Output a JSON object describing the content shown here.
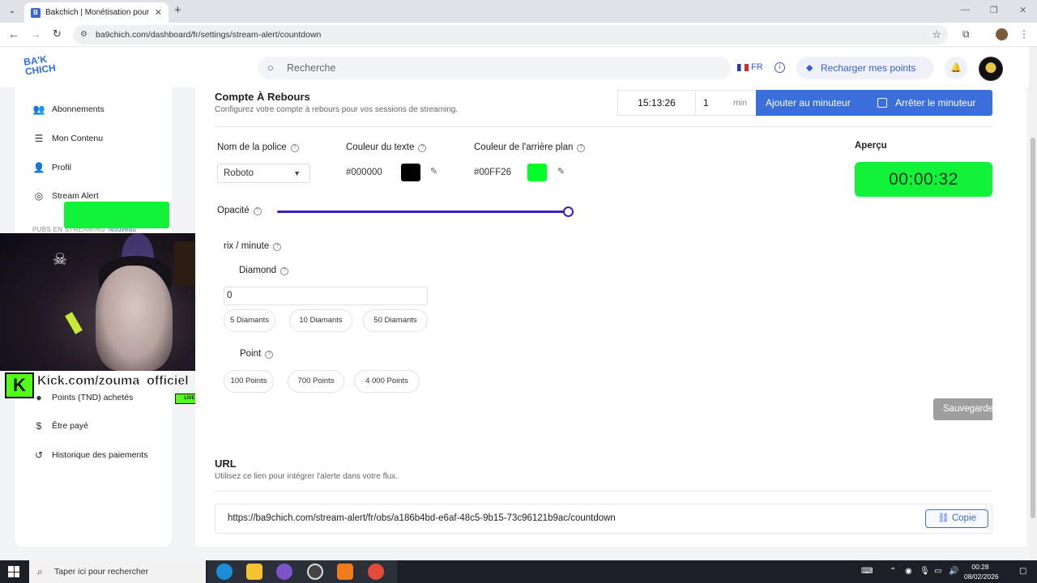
{
  "browser": {
    "tab_title": "Bakchich | Monétisation pour le",
    "tab_favicon": "B",
    "url": "ba9chich.com/dashboard/fr/settings/stream-alert/countdown"
  },
  "header": {
    "logo_line1": "BA'K",
    "logo_line2": "CHICH",
    "search_placeholder": "Recherche",
    "lang": "FR",
    "recharge_label": "Recharger mes points"
  },
  "sidebar": {
    "items": [
      {
        "label": "Abonnements",
        "icon": "users-icon"
      },
      {
        "label": "Mon Contenu",
        "icon": "list-icon"
      },
      {
        "label": "Profil",
        "icon": "user-icon"
      },
      {
        "label": "Stream Alert",
        "icon": "broadcast-icon"
      }
    ],
    "section_label": "PUBS EN STREAMING",
    "section_badge": "Nouveau",
    "bottom_items": [
      {
        "label": "Points (TND) achetés",
        "icon": "coins-icon"
      },
      {
        "label": "Être payé",
        "icon": "dollar-icon"
      },
      {
        "label": "Historique des paiements",
        "icon": "history-icon"
      }
    ]
  },
  "overlay": {
    "kick_text": "Kick.com/zouma_officiel",
    "live": "LIVE"
  },
  "countdown": {
    "title": "Compte À Rebours",
    "subtitle": "Configurez votre compte à rebours pour vos sessions de streaming.",
    "timer_value": "15:13:26",
    "minutes_value": "1",
    "minutes_unit": "min",
    "add_button": "Ajouter au minuteur",
    "stop_button": "Arrêter le minuteur"
  },
  "settings": {
    "font_label": "Nom de la police",
    "font_value": "Roboto",
    "text_color_label": "Couleur du texte",
    "text_color": "#000000",
    "bg_color_label": "Couleur de l'arrière plan",
    "bg_color": "#00FF26",
    "opacity_label": "Opacité",
    "opacity_value": 1.0,
    "preview_label": "Aperçu",
    "preview_time": "00:00:32"
  },
  "pricing": {
    "label": "rix / minute",
    "diamond_label": "Diamond",
    "diamond_value": "0",
    "diamond_options": [
      "5 Diamants",
      "10 Diamants",
      "50 Diamants"
    ],
    "point_label": "Point",
    "point_options": [
      "100 Points",
      "700 Points",
      "4 000 Points"
    ],
    "save_button": "Sauvegarder"
  },
  "url_section": {
    "title": "URL",
    "subtitle": "Utilisez ce lien pour intégrer l'alerte dans votre flux.",
    "url": "https://ba9chich.com/stream-alert/fr/obs/a186b4bd-e6af-48c5-9b15-73c96121b9ac/countdown",
    "copy_button": "Copie"
  },
  "taskbar": {
    "search_placeholder": "Taper ici pour rechercher",
    "time": "00:28",
    "date": "08/02/2026"
  }
}
